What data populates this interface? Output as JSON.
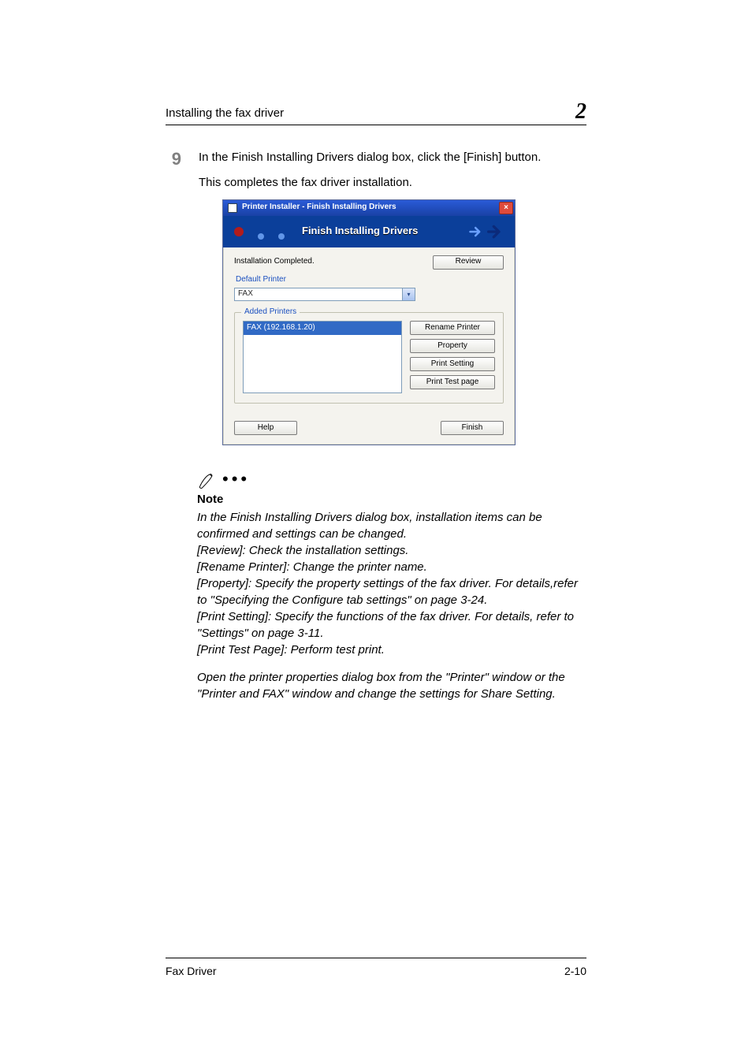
{
  "running_head": "Installing the fax driver",
  "chapter_number": "2",
  "step": {
    "number": "9",
    "text1": "In the Finish Installing Drivers dialog box, click the [Finish] button.",
    "text2": "This completes the fax driver installation."
  },
  "dialog": {
    "titlebar": "Printer Installer - Finish Installing Drivers",
    "banner": "Finish Installing Drivers",
    "status": "Installation Completed.",
    "review_btn": "Review",
    "default_printer_label": "Default Printer",
    "default_printer_value": "FAX",
    "added_printers_label": "Added Printers",
    "list_item": "FAX (192.168.1.20)",
    "rename_btn": "Rename Printer",
    "property_btn": "Property",
    "print_setting_btn": "Print Setting",
    "print_test_btn": "Print Test page",
    "help_btn": "Help",
    "finish_btn": "Finish"
  },
  "note": {
    "heading": "Note",
    "p1": "In the Finish Installing Drivers dialog box, installation items can be confirmed and settings can be changed.",
    "p2": "[Review]: Check the installation settings.",
    "p3": "[Rename Printer]: Change the printer name.",
    "p4": "[Property]: Specify the property settings of the fax driver. For details,refer to \"Specifying the Configure tab settings\" on page 3-24.",
    "p5": "[Print Setting]: Specify the functions of the fax driver. For details, refer to \"Settings\" on page 3-11.",
    "p6": "[Print Test Page]: Perform test print.",
    "p7": "Open the printer properties dialog box from the \"Printer\" window or the \"Printer and FAX\" window and change the settings for Share Setting."
  },
  "footer": {
    "left": "Fax Driver",
    "right": "2-10"
  }
}
